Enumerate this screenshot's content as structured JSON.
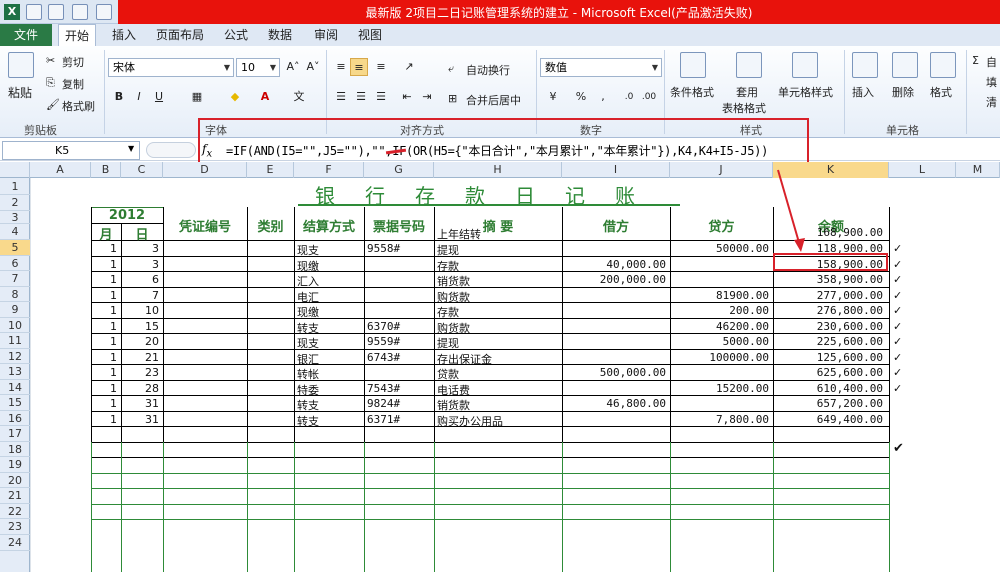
{
  "window": {
    "title": "最新版 2项目二日记账管理系统的建立 - Microsoft Excel(产品激活失败)"
  },
  "tabs": [
    {
      "label": "文件"
    },
    {
      "label": "开始"
    },
    {
      "label": "插入"
    },
    {
      "label": "页面布局"
    },
    {
      "label": "公式"
    },
    {
      "label": "数据"
    },
    {
      "label": "审阅"
    },
    {
      "label": "视图"
    }
  ],
  "ribbon": {
    "clipboard": {
      "paste": "粘贴",
      "cut": "剪切",
      "copy": "复制",
      "format_painter": "格式刷",
      "group": "剪贴板"
    },
    "font": {
      "name": "宋体",
      "size": "10",
      "bold": "B",
      "italic": "I",
      "underline": "U",
      "group": "字体"
    },
    "alignment": {
      "wrap": "自动换行",
      "merge": "合并后居中",
      "group": "对齐方式"
    },
    "number": {
      "format": "数值",
      "percent": "%",
      "comma": ",",
      "group": "数字"
    },
    "styles": {
      "conditional": "条件格式",
      "table1": "套用",
      "table2": "表格格式",
      "cell_styles": "单元格样式",
      "group": "样式"
    },
    "cells": {
      "insert": "插入",
      "delete": "删除",
      "format": "格式",
      "group": "单元格"
    },
    "editing": {
      "sum": "Σ",
      "auto": "自",
      "fill": "填",
      "clear": "清"
    }
  },
  "namebox": "K5",
  "formula": "=IF(AND(I5=\"\",J5=\"\"),\"\",IF(OR(H5={\"本日合计\",\"本月累计\",\"本年累计\"}),K4,K4+I5-J5))",
  "columns": [
    "A",
    "B",
    "C",
    "D",
    "E",
    "F",
    "G",
    "H",
    "I",
    "J",
    "K",
    "L",
    "M"
  ],
  "rows": [
    "1",
    "2",
    "3",
    "4",
    "5",
    "6",
    "7",
    "8",
    "9",
    "10",
    "11",
    "12",
    "13",
    "14",
    "15",
    "16",
    "17",
    "18",
    "19",
    "20",
    "21",
    "22",
    "23",
    "24"
  ],
  "sheet": {
    "title": "银行存款日记账",
    "year": "2012",
    "month": "月",
    "day": "日",
    "headers": {
      "voucher": "凭证编号",
      "type": "类别",
      "method": "结算方式",
      "bill": "票据号码",
      "summary": "摘 要",
      "debit": "借方",
      "credit": "贷方",
      "balance": "余额"
    },
    "entries": [
      {
        "m": "",
        "d": "",
        "method": "",
        "bill": "",
        "summary": "上年结转",
        "debit": "",
        "credit": "",
        "balance": "168,900.00",
        "check": ""
      },
      {
        "m": "1",
        "d": "3",
        "method": "现支",
        "bill": "9558#",
        "summary": "提现",
        "debit": "",
        "credit": "50000.00",
        "balance": "118,900.00",
        "check": "✓"
      },
      {
        "m": "1",
        "d": "3",
        "method": "现缴",
        "bill": "",
        "summary": "存款",
        "debit": "40,000.00",
        "credit": "",
        "balance": "158,900.00",
        "check": "✓"
      },
      {
        "m": "1",
        "d": "6",
        "method": "汇入",
        "bill": "",
        "summary": "销货款",
        "debit": "200,000.00",
        "credit": "",
        "balance": "358,900.00",
        "check": "✓"
      },
      {
        "m": "1",
        "d": "7",
        "method": "电汇",
        "bill": "",
        "summary": "购货款",
        "debit": "",
        "credit": "81900.00",
        "balance": "277,000.00",
        "check": "✓"
      },
      {
        "m": "1",
        "d": "10",
        "method": "现缴",
        "bill": "",
        "summary": "存款",
        "debit": "",
        "credit": "200.00",
        "balance": "276,800.00",
        "check": "✓"
      },
      {
        "m": "1",
        "d": "15",
        "method": "转支",
        "bill": "6370#",
        "summary": "购货款",
        "debit": "",
        "credit": "46200.00",
        "balance": "230,600.00",
        "check": "✓"
      },
      {
        "m": "1",
        "d": "20",
        "method": "现支",
        "bill": "9559#",
        "summary": "提现",
        "debit": "",
        "credit": "5000.00",
        "balance": "225,600.00",
        "check": "✓"
      },
      {
        "m": "1",
        "d": "21",
        "method": "银汇",
        "bill": "6743#",
        "summary": "存出保证金",
        "debit": "",
        "credit": "100000.00",
        "balance": "125,600.00",
        "check": "✓"
      },
      {
        "m": "1",
        "d": "23",
        "method": "转帐",
        "bill": "",
        "summary": "贷款",
        "debit": "500,000.00",
        "credit": "",
        "balance": "625,600.00",
        "check": "✓"
      },
      {
        "m": "1",
        "d": "28",
        "method": "特委",
        "bill": "7543#",
        "summary": "电话费",
        "debit": "",
        "credit": "15200.00",
        "balance": "610,400.00",
        "check": "✓"
      },
      {
        "m": "1",
        "d": "31",
        "method": "转支",
        "bill": "9824#",
        "summary": "销货款",
        "debit": "46,800.00",
        "credit": "",
        "balance": "657,200.00",
        "check": ""
      },
      {
        "m": "1",
        "d": "31",
        "method": "转支",
        "bill": "6371#",
        "summary": "购买办公用品",
        "debit": "",
        "credit": "7,800.00",
        "balance": "649,400.00",
        "check": ""
      }
    ],
    "row17_mark": "✔"
  },
  "colors": {
    "excel_green": "#1e7145",
    "title_red": "#e8120c",
    "annotation_red": "#d8212a",
    "sheet_green": "#2e8b38"
  }
}
